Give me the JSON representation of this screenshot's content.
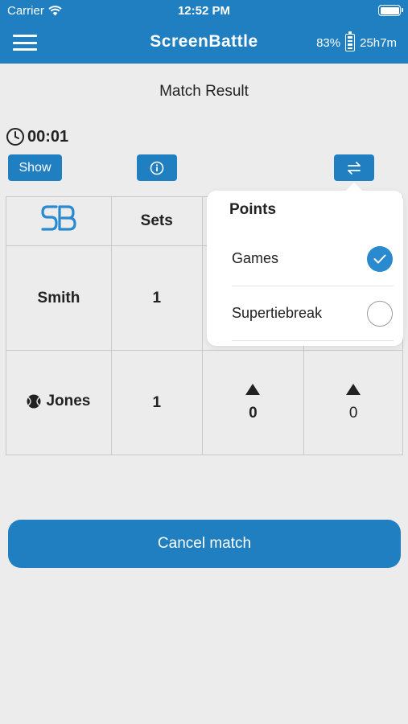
{
  "status_bar": {
    "carrier": "Carrier",
    "time": "12:52 PM"
  },
  "navbar": {
    "title": "ScreenBattle",
    "battery_percent": "83%",
    "battery_time": "25h7m"
  },
  "page": {
    "title": "Match Result",
    "timer": "00:01"
  },
  "toolbar": {
    "show_label": "Show",
    "info_icon": "info-icon",
    "swap_icon": "swap-arrows-icon"
  },
  "table": {
    "sets_header": "Sets",
    "players": [
      {
        "name": "Smith",
        "sets": "1",
        "serving": false
      },
      {
        "name": "Jones",
        "sets": "1",
        "serving": true,
        "col3": "0",
        "col4": "0"
      }
    ]
  },
  "popover": {
    "title": "Points",
    "options": [
      {
        "label": "Games",
        "selected": true
      },
      {
        "label": "Supertiebreak",
        "selected": false
      }
    ]
  },
  "actions": {
    "cancel_label": "Cancel match"
  },
  "colors": {
    "primary": "#1f7fc1",
    "background": "#ececec"
  }
}
